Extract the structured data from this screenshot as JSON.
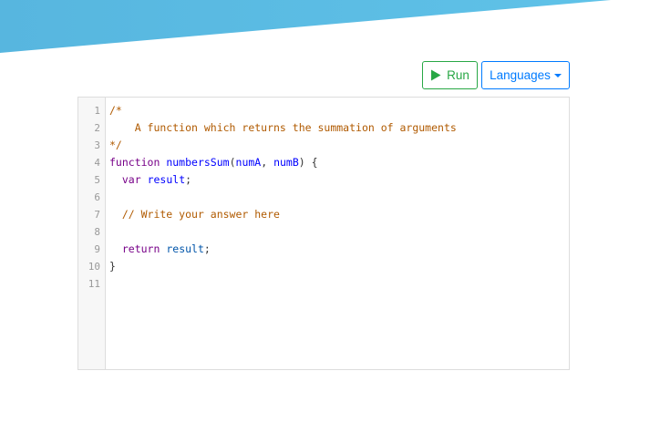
{
  "toolbar": {
    "run_label": "Run",
    "languages_label": "Languages"
  },
  "editor": {
    "line_numbers": [
      "1",
      "2",
      "3",
      "4",
      "5",
      "6",
      "7",
      "8",
      "9",
      "10",
      "11"
    ],
    "lines": [
      [
        {
          "t": "/*",
          "c": "comment"
        }
      ],
      [
        {
          "t": "    A function which returns the summation of arguments",
          "c": "comment"
        }
      ],
      [
        {
          "t": "*/",
          "c": "comment"
        }
      ],
      [
        {
          "t": "function",
          "c": "keyword"
        },
        {
          "t": " ",
          "c": "plain"
        },
        {
          "t": "numbersSum",
          "c": "def"
        },
        {
          "t": "(",
          "c": "plain"
        },
        {
          "t": "numA",
          "c": "def"
        },
        {
          "t": ", ",
          "c": "plain"
        },
        {
          "t": "numB",
          "c": "def"
        },
        {
          "t": ") {",
          "c": "plain"
        }
      ],
      [
        {
          "t": "  ",
          "c": "plain"
        },
        {
          "t": "var",
          "c": "keyword"
        },
        {
          "t": " ",
          "c": "plain"
        },
        {
          "t": "result",
          "c": "def"
        },
        {
          "t": ";",
          "c": "plain"
        }
      ],
      [],
      [
        {
          "t": "  // Write your answer here",
          "c": "comment"
        }
      ],
      [],
      [
        {
          "t": "  ",
          "c": "plain"
        },
        {
          "t": "return",
          "c": "keyword"
        },
        {
          "t": " ",
          "c": "plain"
        },
        {
          "t": "result",
          "c": "variable"
        },
        {
          "t": ";",
          "c": "plain"
        }
      ],
      [
        {
          "t": "}",
          "c": "plain"
        }
      ],
      []
    ]
  },
  "colors": {
    "banner": "#5bbde4",
    "run": "#28a745",
    "languages": "#007bff"
  },
  "icons": {
    "run": "play-icon",
    "languages": "caret-down-icon"
  }
}
